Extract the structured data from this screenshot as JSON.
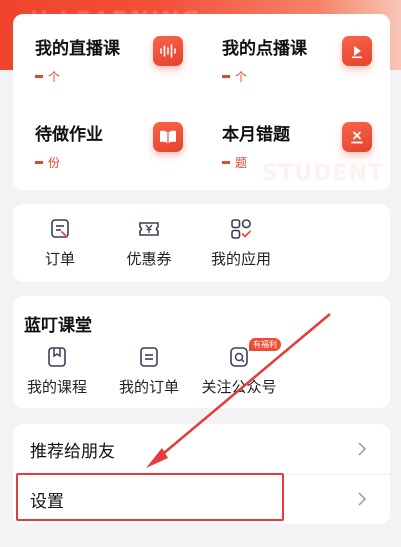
{
  "watermarks": {
    "top": "U LEARNING",
    "student": "STUDENT"
  },
  "stats": [
    {
      "title": "我的直播课",
      "value": "个",
      "icon": "audio-wave-icon"
    },
    {
      "title": "我的点播课",
      "value": "个",
      "icon": "video-play-icon"
    },
    {
      "title": "待做作业",
      "value": "份",
      "icon": "open-book-icon"
    },
    {
      "title": "本月错题",
      "value": "题",
      "icon": "wrong-answer-icon"
    }
  ],
  "quick_actions": [
    {
      "label": "订单",
      "icon": "order-doc-icon"
    },
    {
      "label": "优惠券",
      "icon": "coupon-yen-icon"
    },
    {
      "label": "我的应用",
      "icon": "apps-grid-icon"
    }
  ],
  "ting_section": {
    "title": "蓝叮课堂",
    "items": [
      {
        "label": "我的课程",
        "icon": "bookmark-book-icon"
      },
      {
        "label": "我的订单",
        "icon": "order-list-icon"
      },
      {
        "label": "关注公众号",
        "icon": "subscribe-icon",
        "badge": "有福利"
      }
    ]
  },
  "menu": [
    {
      "label": "推荐给朋友"
    },
    {
      "label": "设置"
    }
  ],
  "colors": {
    "accent": "#e8412b",
    "highlight": "#e43b3b"
  }
}
